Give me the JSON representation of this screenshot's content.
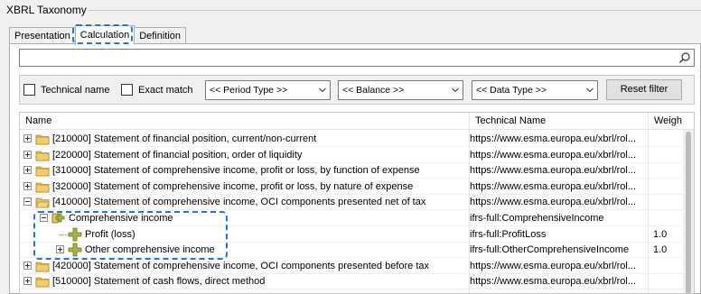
{
  "window": {
    "title": "XBRL Taxonomy"
  },
  "tabs": [
    {
      "label": "Presentation",
      "active": false
    },
    {
      "label": "Calculation",
      "active": true
    },
    {
      "label": "Definition",
      "active": false
    }
  ],
  "search": {
    "value": "",
    "icon": "search-icon"
  },
  "filters": {
    "technical_name_label": "Technical name",
    "exact_match_label": "Exact match",
    "period_type": "<< Period Type >>",
    "balance": "<< Balance >>",
    "data_type": "<< Data Type >>",
    "reset_label": "Reset filter"
  },
  "grid": {
    "columns": [
      "Name",
      "Technical Name",
      "Weigh"
    ],
    "rows": [
      {
        "name": "[210000] Statement of financial position, current/non-current",
        "tech": "https://www.esma.europa.eu/xbrl/rol...",
        "weight": "",
        "icon": "folder-icon",
        "expander": "plus"
      },
      {
        "name": "[220000] Statement of financial position, order of liquidity",
        "tech": "https://www.esma.europa.eu/xbrl/rol...",
        "weight": "",
        "icon": "folder-icon",
        "expander": "plus"
      },
      {
        "name": "[310000] Statement of comprehensive income, profit or loss, by function of expense",
        "tech": "https://www.esma.europa.eu/xbrl/rol...",
        "weight": "",
        "icon": "folder-icon",
        "expander": "plus"
      },
      {
        "name": "[320000] Statement of comprehensive income, profit or loss, by nature of expense",
        "tech": "https://www.esma.europa.eu/xbrl/rol...",
        "weight": "",
        "icon": "folder-icon",
        "expander": "plus"
      },
      {
        "name": "[410000] Statement of comprehensive income, OCI components presented net of tax",
        "tech": "https://www.esma.europa.eu/xbrl/rol...",
        "weight": "",
        "icon": "folder-open-icon",
        "expander": "minus"
      },
      {
        "name": "Comprehensive income",
        "tech": "ifrs-full:ComprehensiveIncome",
        "weight": "",
        "icon": "calc-root-icon",
        "expander": "minus"
      },
      {
        "name": "Profit (loss)",
        "tech": "ifrs-full:ProfitLoss",
        "weight": "1.0",
        "icon": "plus-cross-icon",
        "expander": ""
      },
      {
        "name": "Other comprehensive income",
        "tech": "ifrs-full:OtherComprehensiveIncome",
        "weight": "1.0",
        "icon": "plus-cross-icon",
        "expander": "plus"
      },
      {
        "name": "[420000] Statement of comprehensive income, OCI components presented before tax",
        "tech": "https://www.esma.europa.eu/xbrl/rol...",
        "weight": "",
        "icon": "folder-icon",
        "expander": "plus"
      },
      {
        "name": "[510000] Statement of cash flows, direct method",
        "tech": "https://www.esma.europa.eu/xbrl/rol...",
        "weight": "",
        "icon": "folder-icon",
        "expander": "plus"
      }
    ]
  },
  "colors": {
    "highlight": "#1f77d0",
    "folder": "#e8c35a",
    "calc_cross": "#a8b43a"
  }
}
